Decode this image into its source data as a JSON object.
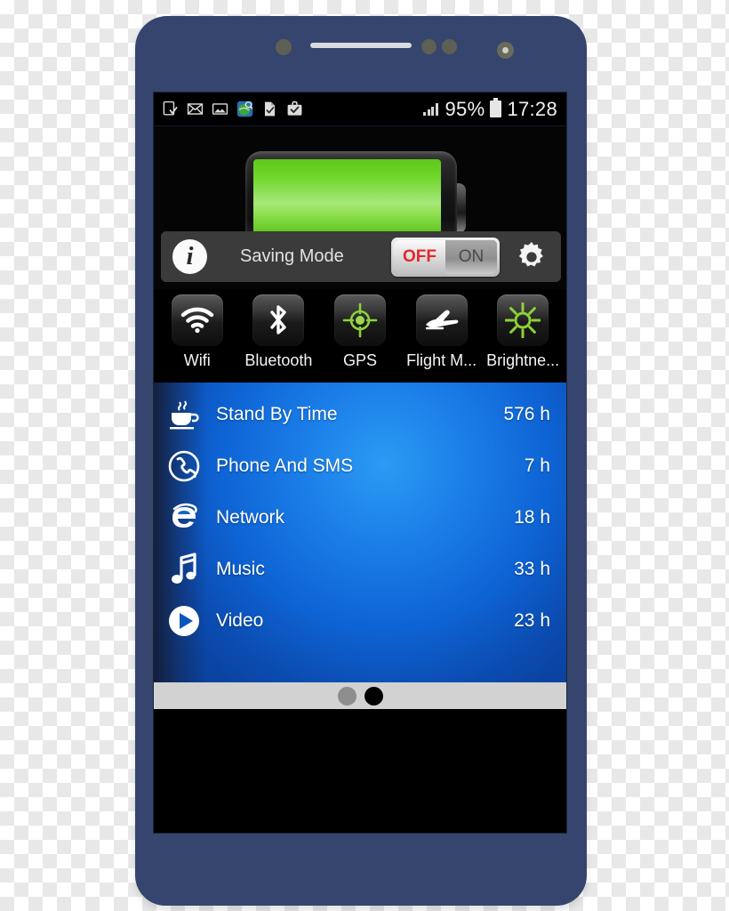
{
  "device": {
    "name": "smartphone-mockup",
    "body_color": "#35456e",
    "earpiece": "speaker-grille"
  },
  "statusbar": {
    "left_icons": [
      "download-complete-icon",
      "email-icon",
      "screenshot-image-icon",
      "map-globe-icon",
      "document-check-icon",
      "briefcase-check-icon"
    ],
    "signal_icon": "signal-bars-icon",
    "battery_percent": "95%",
    "battery_icon": "battery-full-icon",
    "time": "17:28"
  },
  "battery_panel": {
    "icon": "battery-horizontal-icon",
    "fill_color": "#6fd62a",
    "level_percent": 95
  },
  "saving_mode": {
    "info_icon": "info-icon",
    "info_glyph": "i",
    "label": "Saving Mode",
    "toggle": {
      "off_label": "OFF",
      "on_label": "ON",
      "state": "OFF",
      "off_color": "#e2282c"
    },
    "settings_icon": "gear-icon"
  },
  "quick_toggles": [
    {
      "label": "Wifi",
      "icon": "wifi-icon",
      "color": "#ffffff"
    },
    {
      "label": "Bluetooth",
      "icon": "bluetooth-icon",
      "color": "#ffffff"
    },
    {
      "label": "GPS",
      "icon": "gps-crosshair-icon",
      "color": "#8cd13a"
    },
    {
      "label": "Flight M...",
      "icon": "airplane-icon",
      "color": "#ffffff"
    },
    {
      "label": "Brightne...",
      "icon": "brightness-sun-icon",
      "color": "#8cd13a"
    }
  ],
  "usage_list": [
    {
      "label": "Stand By Time",
      "value": "576 h",
      "icon": "coffee-cup-icon"
    },
    {
      "label": "Phone And SMS",
      "value": "7 h",
      "icon": "phone-handset-icon"
    },
    {
      "label": "Network",
      "value": "18 h",
      "icon": "browser-e-icon"
    },
    {
      "label": "Music",
      "value": "33 h",
      "icon": "music-note-icon"
    },
    {
      "label": "Video",
      "value": "23 h",
      "icon": "play-button-icon"
    }
  ],
  "page_indicator": {
    "dots": [
      {
        "state": "inactive"
      },
      {
        "state": "active"
      }
    ],
    "current_page": 2,
    "total_pages": 2
  }
}
